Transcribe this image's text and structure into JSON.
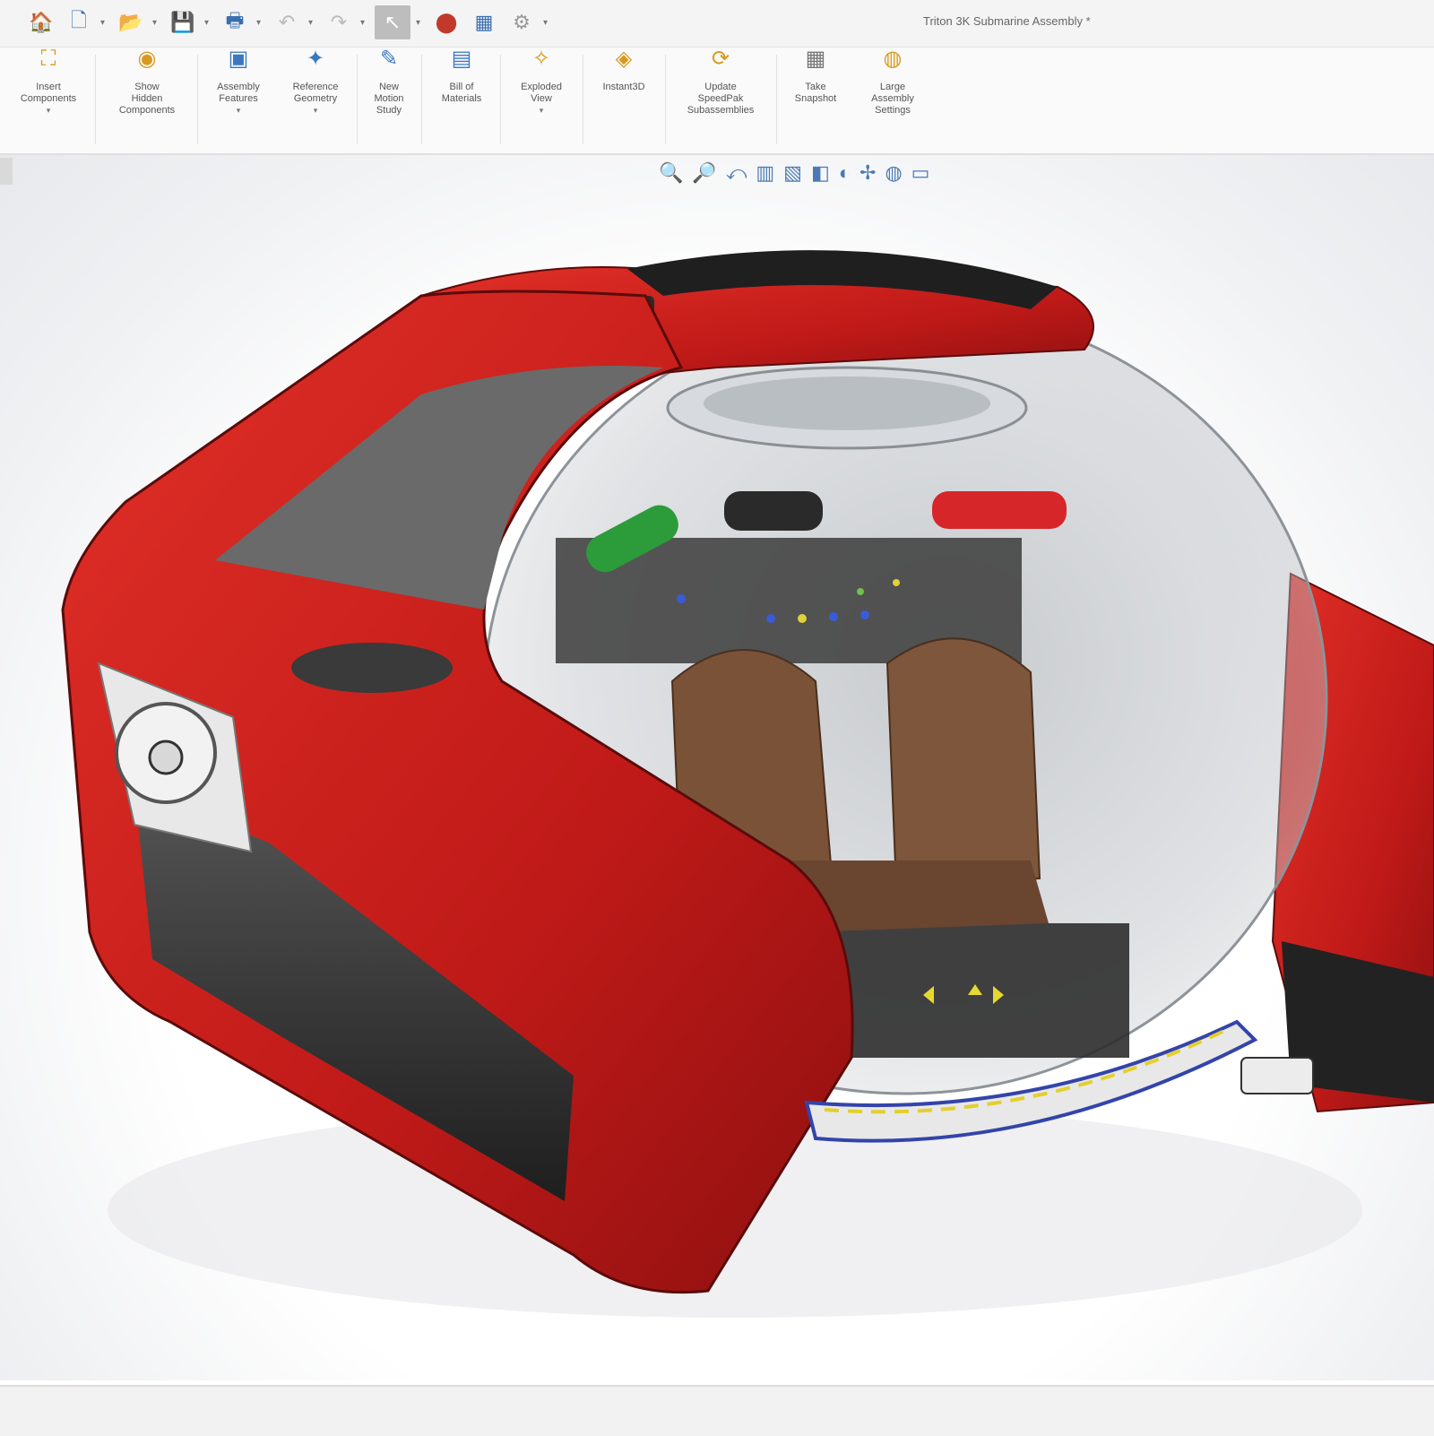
{
  "window": {
    "title": "Triton 3K Submarine Assembly *"
  },
  "quick_access": {
    "home": "🏠",
    "new": "🗋",
    "open": "📂",
    "save": "💾",
    "print": "🖶",
    "undo": "↶",
    "redo": "↷",
    "select": "↖",
    "rebuild": "⬤",
    "options": "▦",
    "settings": "⚙"
  },
  "ribbon": {
    "items": [
      {
        "icon": "insert-components-icon",
        "glyph": "⛶",
        "label": "Insert\nComponents",
        "dropdown": true
      },
      {
        "icon": "show-hidden-components-icon",
        "glyph": "◉",
        "label": "Show\nHidden\nComponents",
        "dropdown": false
      },
      {
        "icon": "assembly-features-icon",
        "glyph": "▣",
        "label": "Assembly\nFeatures",
        "dropdown": true
      },
      {
        "icon": "reference-geometry-icon",
        "glyph": "✦",
        "label": "Reference\nGeometry",
        "dropdown": true
      },
      {
        "icon": "new-motion-study-icon",
        "glyph": "✎",
        "label": "New\nMotion\nStudy",
        "dropdown": false
      },
      {
        "icon": "bill-of-materials-icon",
        "glyph": "▤",
        "label": "Bill of\nMaterials",
        "dropdown": false
      },
      {
        "icon": "exploded-view-icon",
        "glyph": "✧",
        "label": "Exploded\nView",
        "dropdown": true
      },
      {
        "icon": "instant3d-icon",
        "glyph": "◈",
        "label": "Instant3D",
        "dropdown": false
      },
      {
        "icon": "update-speedpak-icon",
        "glyph": "⟳",
        "label": "Update\nSpeedPak\nSubassemblies",
        "dropdown": false
      },
      {
        "icon": "take-snapshot-icon",
        "glyph": "▦",
        "label": "Take\nSnapshot",
        "dropdown": false
      },
      {
        "icon": "large-assembly-settings-icon",
        "glyph": "◍",
        "label": "Large\nAssembly\nSettings",
        "dropdown": false
      }
    ]
  },
  "heads_up": {
    "tools": [
      "zoom-to-fit-icon",
      "zoom-to-area-icon",
      "previous-view-icon",
      "section-view-icon",
      "view-orientation-icon",
      "display-style-icon",
      "hide-show-items-icon",
      "edit-appearance-icon",
      "apply-scene-icon",
      "view-settings-icon"
    ],
    "glyphs": [
      "🔍",
      "🔎",
      "⤺",
      "▥",
      "▧",
      "◧",
      "◐",
      "✢",
      "◍",
      "▭"
    ]
  },
  "colors": {
    "hull_red": "#c81e1e",
    "dark_panel": "#2b2b2b",
    "dome_glass": "#cfd4d8",
    "seat_brown": "#7a5238",
    "toolbar_bg": "#f4f4f4"
  }
}
